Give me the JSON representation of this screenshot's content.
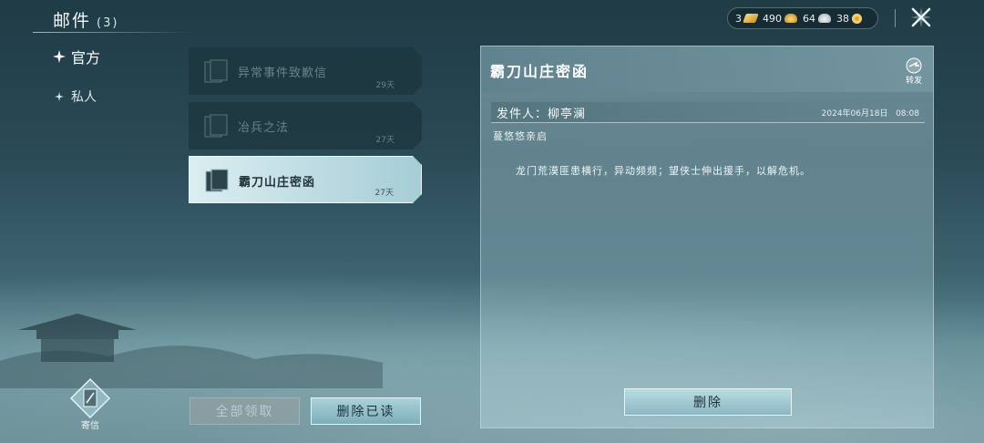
{
  "header": {
    "title": "邮件",
    "count": "(3)"
  },
  "currency": [
    {
      "icon": "gold-bar-icon",
      "value": "3"
    },
    {
      "icon": "gold-ingot-icon",
      "value": "490"
    },
    {
      "icon": "silver-ingot-icon",
      "value": "64"
    },
    {
      "icon": "coin-icon",
      "value": "38"
    }
  ],
  "tabs": [
    {
      "label": "官方",
      "icon": "sparkle-icon",
      "active": true
    },
    {
      "label": "私人",
      "icon": "star-icon",
      "active": false
    }
  ],
  "mail_list": [
    {
      "subject": "异常事件致歉信",
      "days": "29天",
      "active": false
    },
    {
      "subject": "冶兵之法",
      "days": "27天",
      "active": false
    },
    {
      "subject": "霸刀山庄密函",
      "days": "27天",
      "active": true
    }
  ],
  "send": {
    "label": "寄信"
  },
  "buttons": {
    "claim_all": "全部领取",
    "delete_read": "删除已读",
    "delete": "删除"
  },
  "detail": {
    "title": "霸刀山庄密函",
    "forward_label": "转发",
    "sender": "发件人：柳亭澜",
    "date": "2024年06月18日",
    "time": "08:08",
    "greeting": "蔓悠悠亲启",
    "body": "龙门荒漠匪患横行，异动频频；望侠士伸出援手，以解危机。"
  },
  "colors": {
    "accent": "#a6cdd6",
    "panel": "#7fa6b0",
    "background": "#2a4a56"
  }
}
